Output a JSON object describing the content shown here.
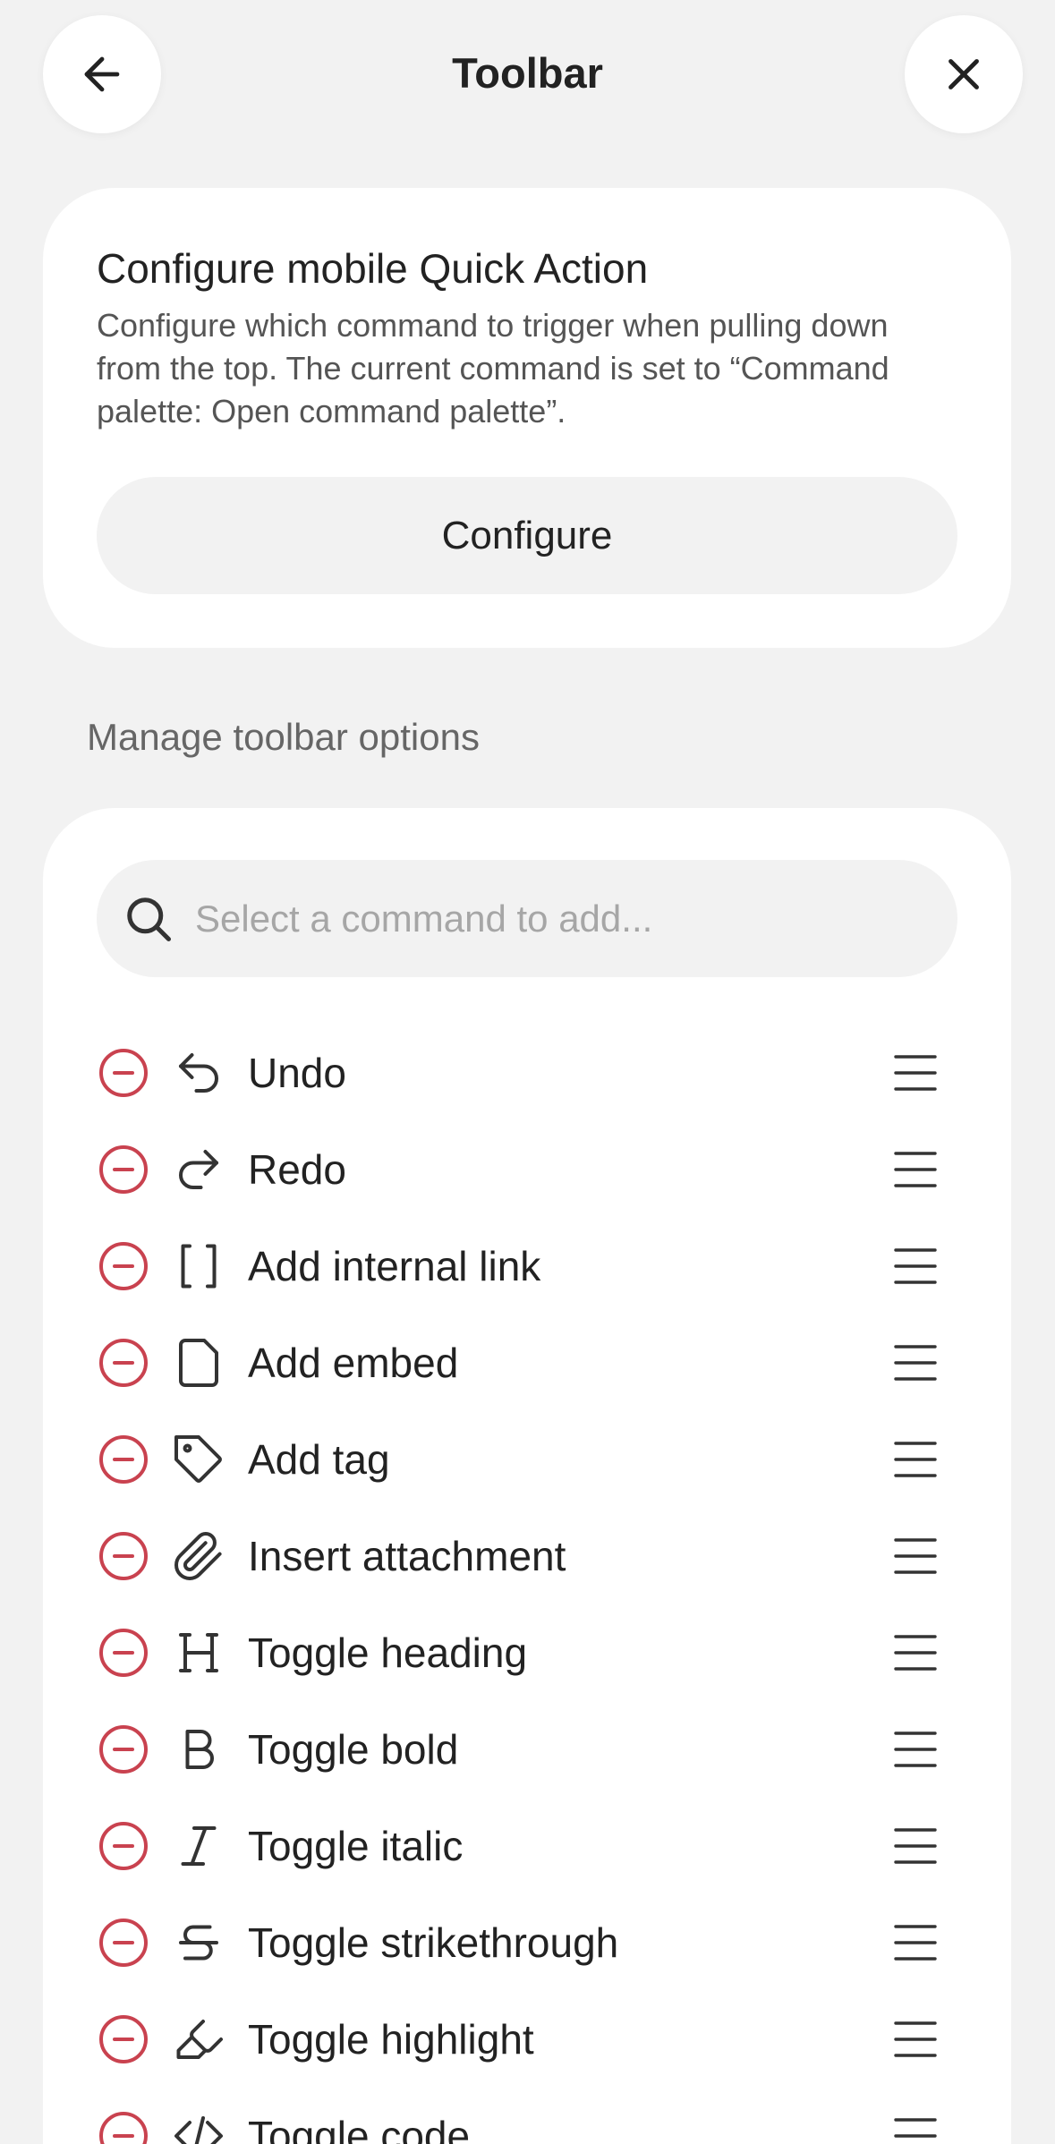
{
  "header": {
    "title": "Toolbar",
    "back_icon": "arrow-left-icon",
    "close_icon": "close-icon"
  },
  "quick_action": {
    "title": "Configure mobile Quick Action",
    "description": "Configure which command to trigger when pulling down from the top. The current command is set to “Command palette: Open command palette”.",
    "button_label": "Configure"
  },
  "toolbar_options": {
    "section_label": "Manage toolbar options",
    "search_placeholder": "Select a command to add...",
    "items": [
      {
        "label": "Undo",
        "icon": "undo-icon"
      },
      {
        "label": "Redo",
        "icon": "redo-icon"
      },
      {
        "label": "Add internal link",
        "icon": "brackets-icon"
      },
      {
        "label": "Add embed",
        "icon": "file-icon"
      },
      {
        "label": "Add tag",
        "icon": "tag-icon"
      },
      {
        "label": "Insert attachment",
        "icon": "paperclip-icon"
      },
      {
        "label": "Toggle heading",
        "icon": "heading-icon"
      },
      {
        "label": "Toggle bold",
        "icon": "bold-icon"
      },
      {
        "label": "Toggle italic",
        "icon": "italic-icon"
      },
      {
        "label": "Toggle strikethrough",
        "icon": "strikethrough-icon"
      },
      {
        "label": "Toggle highlight",
        "icon": "highlighter-icon"
      },
      {
        "label": "Toggle code",
        "icon": "code-icon"
      }
    ]
  },
  "colors": {
    "background": "#f2f2f2",
    "card": "#ffffff",
    "remove": "#c9424f",
    "text": "#222222",
    "muted": "#666666"
  }
}
